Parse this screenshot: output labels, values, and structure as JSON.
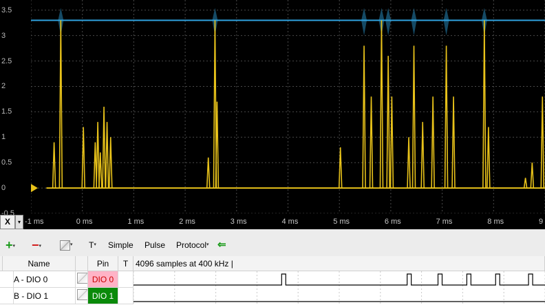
{
  "scope": {
    "y_tick_labels": [
      "3.5",
      "3",
      "2.5",
      "2",
      "1.5",
      "1",
      "0.5",
      "0",
      "-0.5"
    ],
    "x_tick_labels": [
      "-1 ms",
      "0 ms",
      "1 ms",
      "2 ms",
      "3 ms",
      "4 ms",
      "5 ms",
      "6 ms",
      "7 ms",
      "8 ms",
      "9"
    ],
    "x_axis_button": "X",
    "trace_colors": {
      "dio0": "#e8c21a",
      "dio1": "#2fa3e0"
    },
    "chart_data": {
      "type": "line",
      "title": "",
      "xlabel": "",
      "ylabel": "",
      "xlim": [
        -1,
        9
      ],
      "ylim": [
        -0.5,
        3.7
      ],
      "series": [
        {
          "color": "#2fa3e0",
          "x": [
            -1,
            9
          ],
          "y": [
            3.3,
            3.3
          ]
        },
        {
          "color": "#e8c21a",
          "spikes_x": [
            -0.55,
            -0.42,
            0.02,
            0.25,
            0.3,
            0.35,
            0.42,
            0.48,
            0.55,
            2.45,
            2.58,
            2.62,
            5.02,
            5.48,
            5.62,
            5.82,
            5.95,
            6.02,
            6.35,
            6.45,
            6.62,
            6.82,
            7.08,
            7.22,
            7.82,
            7.9,
            8.62,
            8.75,
            8.95
          ],
          "spikes_y": [
            0.9,
            3.3,
            1.2,
            0.9,
            1.3,
            0.7,
            1.6,
            1.3,
            1.0,
            0.6,
            3.3,
            1.7,
            0.8,
            2.8,
            1.8,
            3.3,
            2.6,
            1.8,
            1.0,
            2.8,
            1.3,
            1.8,
            2.8,
            1.8,
            3.3,
            1.2,
            0.2,
            0.5,
            1.8
          ]
        }
      ]
    }
  },
  "toolbar": {
    "add_label": "+",
    "remove_label": "−",
    "t_label": "T",
    "simple_label": "Simple",
    "pulse_label": "Pulse",
    "protocol_label": "Protocol",
    "dropdown_glyph": "▾",
    "back_glyph": "⇐"
  },
  "grid": {
    "headers": {
      "name": "Name",
      "pin": "Pin",
      "t": "T",
      "info": "4096 samples at 400 kHz |"
    },
    "rows": [
      {
        "name": "A - DIO 0",
        "pin": "DIO  0",
        "pin_bg": "#ffb3c6",
        "pin_fg": "#cc0000",
        "pulses_ms": [
          2.6,
          5.65,
          6.4,
          7.1,
          7.8,
          8.6
        ]
      },
      {
        "name": "B - DIO 1",
        "pin": "DIO  1",
        "pin_bg": "#0a8a0a",
        "pin_fg": "#ffffff",
        "pulses_ms": []
      }
    ]
  }
}
